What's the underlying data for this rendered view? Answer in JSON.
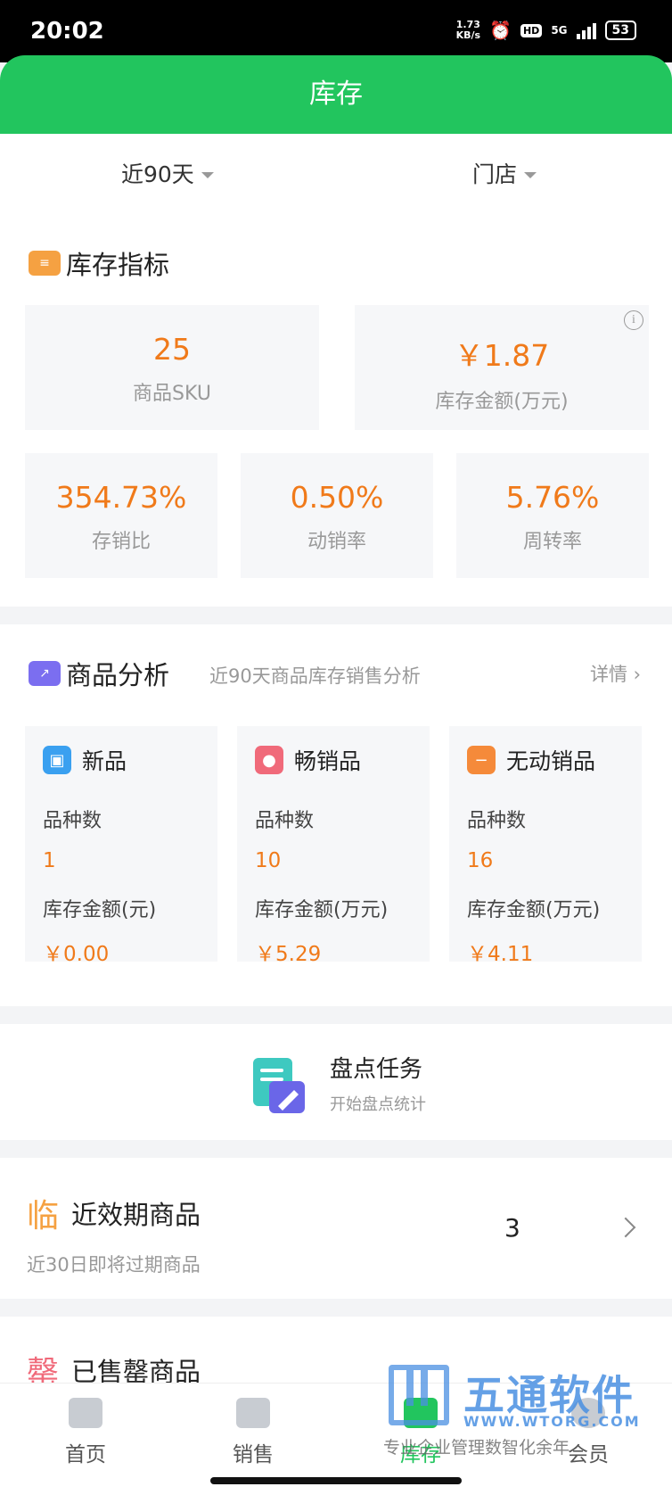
{
  "status_bar": {
    "time": "20:02",
    "net_speed_value": "1.73",
    "net_speed_unit": "KB/s",
    "hd": "HD",
    "network": "5G",
    "battery": "53"
  },
  "app_bar": {
    "title": "库存"
  },
  "filters": {
    "period": "近90天",
    "store": "门店"
  },
  "inventory_metrics": {
    "title": "库存指标",
    "icon": "calendar-icon",
    "cards": [
      {
        "value": "25",
        "label": "商品SKU"
      },
      {
        "value": "￥1.87",
        "label": "库存金额(万元)"
      },
      {
        "value": "354.73%",
        "label": "存销比"
      },
      {
        "value": "0.50%",
        "label": "动销率"
      },
      {
        "value": "5.76%",
        "label": "周转率"
      }
    ]
  },
  "product_analysis": {
    "title": "商品分析",
    "icon": "trend-chart-icon",
    "subtitle": "近90天商品库存销售分析",
    "detail_link": "详情",
    "cards": [
      {
        "name": "新品",
        "icon": "shopping-bag-icon",
        "icon_color": "#3aa0f0",
        "count_label": "品种数",
        "count": "1",
        "amount_label": "库存金额(元)",
        "amount": "￥0.00"
      },
      {
        "name": "畅销品",
        "icon": "fire-icon",
        "icon_color": "#f06a7a",
        "count_label": "品种数",
        "count": "10",
        "amount_label": "库存金额(万元)",
        "amount": "￥5.29"
      },
      {
        "name": "无动销品",
        "icon": "minus-icon",
        "icon_color": "#f58a3a",
        "count_label": "品种数",
        "count": "16",
        "amount_label": "库存金额(万元)",
        "amount": "￥4.11"
      }
    ]
  },
  "stocktake": {
    "title": "盘点任务",
    "subtitle": "开始盘点统计",
    "icon": "clipboard-pen-icon"
  },
  "near_expiry": {
    "badge": "临",
    "title": "近效期商品",
    "subtitle": "近30日即将过期商品",
    "count": "3"
  },
  "sold_out": {
    "badge": "罄",
    "title": "已售罄商品"
  },
  "tab_bar": {
    "tabs": [
      {
        "label": "首页",
        "icon": "monitor-icon"
      },
      {
        "label": "销售",
        "icon": "briefcase-icon"
      },
      {
        "label": "库存",
        "icon": "inventory-icon"
      },
      {
        "label": "会员",
        "icon": "member-icon"
      }
    ],
    "active": "库存"
  },
  "watermark": {
    "name": "五通软件",
    "url": "WWW.WTORG.COM",
    "slogan": "专业企业管理数智化余年"
  },
  "colors": {
    "primary": "#22c55e",
    "value_orange": "#f07a1a",
    "card_bg": "#f6f7f9"
  }
}
